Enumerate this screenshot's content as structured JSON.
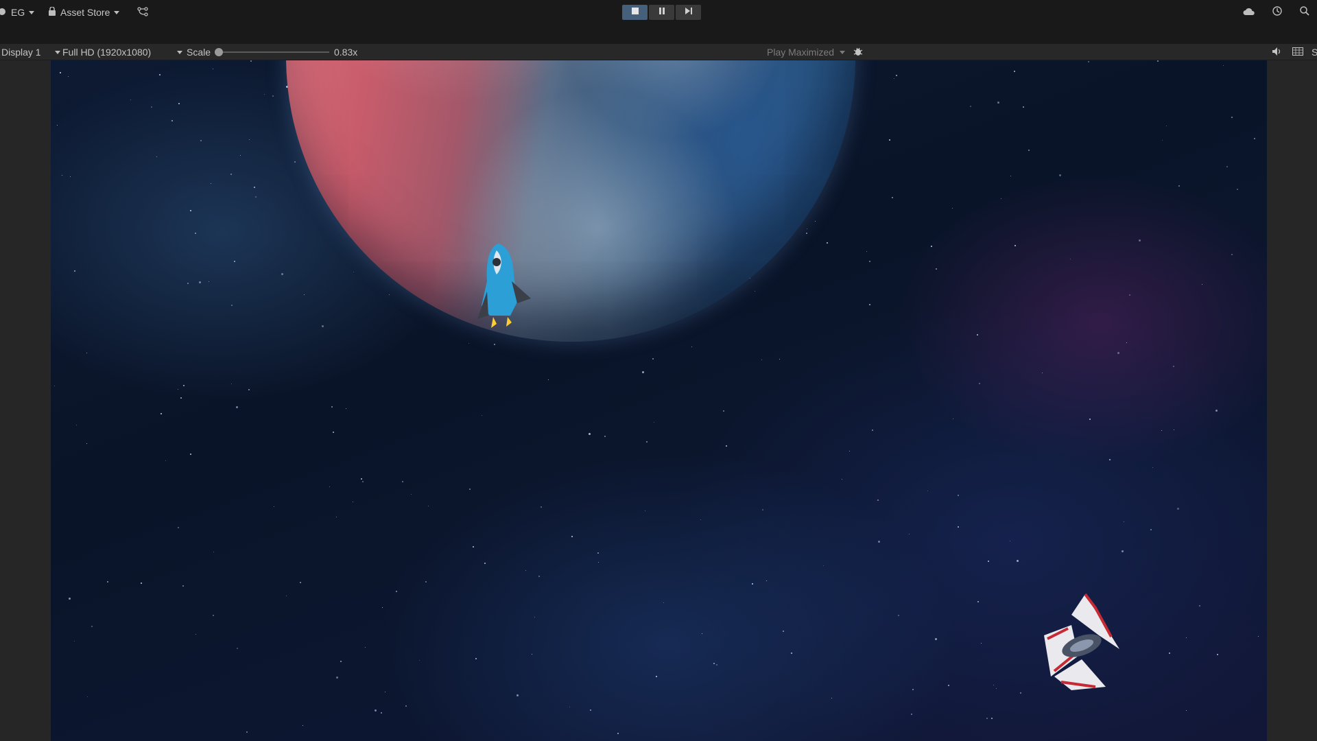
{
  "toolbar": {
    "account_label": "EG",
    "asset_store_label": "Asset Store"
  },
  "game_bar": {
    "display_label": "Display 1",
    "resolution_label": "Full HD (1920x1080)",
    "scale_label": "Scale",
    "scale_value": "0.83x",
    "play_mode_label": "Play Maximized",
    "right_cut_label": "S"
  },
  "colors": {
    "play_active": "#46607c",
    "toolbar_bg": "#191919",
    "gamebar_bg": "#282828"
  },
  "icons": [
    "account-icon",
    "lock-icon",
    "version-control-icon",
    "play-icon",
    "pause-icon",
    "step-icon",
    "cloud-icon",
    "history-icon",
    "search-icon",
    "bug-icon",
    "mute-icon",
    "stats-icon"
  ]
}
